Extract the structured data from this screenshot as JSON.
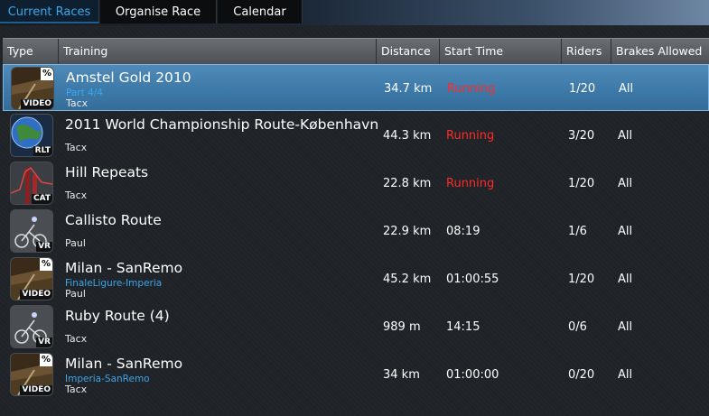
{
  "tabs": [
    {
      "label": "Current Races",
      "active": true
    },
    {
      "label": "Organise Race",
      "active": false
    },
    {
      "label": "Calendar",
      "active": false
    }
  ],
  "columns": [
    "Type",
    "Training",
    "Distance",
    "Start Time",
    "Riders",
    "Brakes Allowed"
  ],
  "colors": {
    "accent": "#3aa8ec",
    "running": "#ff2a2a",
    "selected_row": "#3e7aa9"
  },
  "races": [
    {
      "type": "VIDEO",
      "type_icon": "video-landscape-icon",
      "title": "Amstel Gold 2010",
      "subtitle": "Part 4/4",
      "owner": "Tacx",
      "distance": "34.7 km",
      "start_time": "Running",
      "running": true,
      "riders": "1/20",
      "brakes": "All",
      "selected": true
    },
    {
      "type": "RLT",
      "type_icon": "globe-icon",
      "title": "2011 World Championship Route-København",
      "subtitle": "",
      "owner": "Tacx",
      "distance": "44.3 km",
      "start_time": "Running",
      "running": true,
      "riders": "3/20",
      "brakes": "All",
      "selected": false
    },
    {
      "type": "CAT",
      "type_icon": "slope-chart-icon",
      "title": "Hill Repeats",
      "subtitle": "",
      "owner": "Tacx",
      "distance": "22.8 km",
      "start_time": "Running",
      "running": true,
      "riders": "1/20",
      "brakes": "All",
      "selected": false
    },
    {
      "type": "VR",
      "type_icon": "cyclist-icon",
      "title": "Callisto Route",
      "subtitle": "",
      "owner": "Paul",
      "distance": "22.9 km",
      "start_time": "08:19",
      "running": false,
      "riders": "1/6",
      "brakes": "All",
      "selected": false
    },
    {
      "type": "VIDEO",
      "type_icon": "video-landscape-icon",
      "title": "Milan - SanRemo",
      "subtitle": "FinaleLigure-Imperia",
      "owner": "Paul",
      "distance": "45.2 km",
      "start_time": "01:00:55",
      "running": false,
      "riders": "1/20",
      "brakes": "All",
      "selected": false
    },
    {
      "type": "VR",
      "type_icon": "cyclist-icon",
      "title": "Ruby Route (4)",
      "subtitle": "",
      "owner": "Tacx",
      "distance": "989 m",
      "start_time": "14:15",
      "running": false,
      "riders": "0/6",
      "brakes": "All",
      "selected": false
    },
    {
      "type": "VIDEO",
      "type_icon": "video-landscape-icon",
      "title": "Milan - SanRemo",
      "subtitle": "Imperia-SanRemo",
      "owner": "Tacx",
      "distance": "34 km",
      "start_time": "01:00:00",
      "running": false,
      "riders": "0/20",
      "brakes": "All",
      "selected": false
    }
  ]
}
